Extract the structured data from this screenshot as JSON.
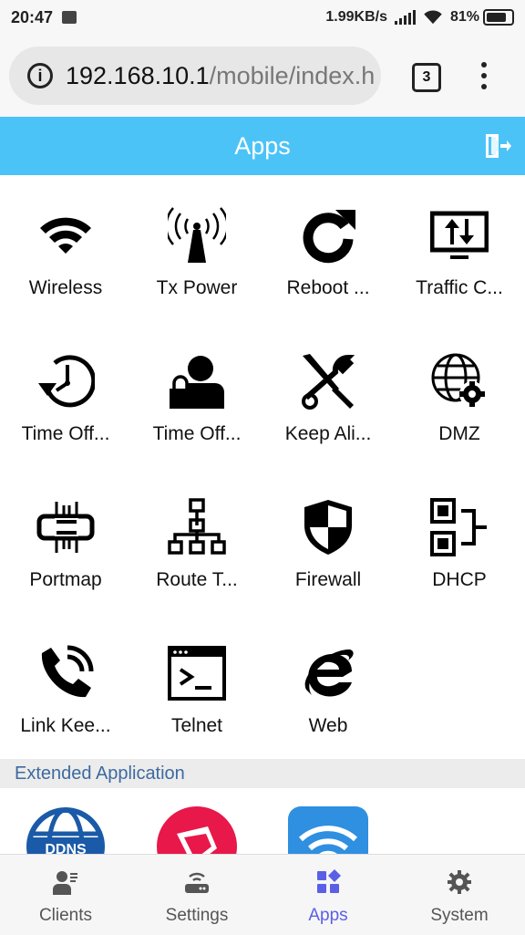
{
  "status_bar": {
    "time": "20:47",
    "speed": "1.99KB/s",
    "battery": "81%"
  },
  "browser": {
    "url_host": "192.168.10.1",
    "url_path": "/mobile/index.h",
    "tab_count": "3"
  },
  "header": {
    "title": "Apps"
  },
  "apps": [
    {
      "label": "Wireless",
      "icon": "wifi-icon"
    },
    {
      "label": "Tx Power",
      "icon": "antenna-icon"
    },
    {
      "label": "Reboot ...",
      "icon": "reboot-icon"
    },
    {
      "label": "Traffic C...",
      "icon": "traffic-icon"
    },
    {
      "label": "Time Off...",
      "icon": "clock-reverse-icon"
    },
    {
      "label": "Time Off...",
      "icon": "user-lock-icon"
    },
    {
      "label": "Keep Ali...",
      "icon": "tools-icon"
    },
    {
      "label": "DMZ",
      "icon": "globe-gear-icon"
    },
    {
      "label": "Portmap",
      "icon": "portmap-icon"
    },
    {
      "label": "Route T...",
      "icon": "route-tree-icon"
    },
    {
      "label": "Firewall",
      "icon": "shield-icon"
    },
    {
      "label": "DHCP",
      "icon": "dhcp-icon"
    },
    {
      "label": "Link Kee...",
      "icon": "phone-icon"
    },
    {
      "label": "Telnet",
      "icon": "terminal-icon"
    },
    {
      "label": "Web",
      "icon": "ie-icon"
    }
  ],
  "extended": {
    "title": "Extended Application"
  },
  "bottom_nav": [
    {
      "label": "Clients",
      "icon": "clients-icon"
    },
    {
      "label": "Settings",
      "icon": "router-icon"
    },
    {
      "label": "Apps",
      "icon": "apps-icon"
    },
    {
      "label": "System",
      "icon": "gear-icon"
    }
  ],
  "colors": {
    "header": "#4cc3f7",
    "active": "#5b5fe6",
    "extended_title": "#3d6aa0"
  }
}
